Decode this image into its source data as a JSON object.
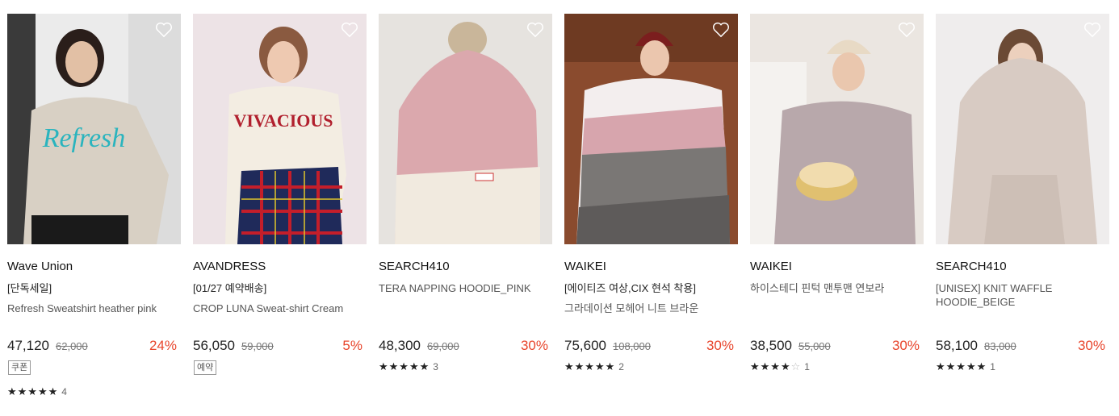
{
  "products": [
    {
      "brand": "Wave Union",
      "tag": "[단독세일]",
      "name": "Refresh Sweatshirt heather pink",
      "price": "47,120",
      "original_price": "62,000",
      "discount": "24%",
      "badge": "쿠폰",
      "rating_stars": "★★★★★",
      "review_count": "4",
      "colors": {
        "bg": "#ececec",
        "top": "#d9d2c6",
        "accent": "#29b6c0"
      }
    },
    {
      "brand": "AVANDRESS",
      "tag": "[01/27 예약배송]",
      "name": "CROP LUNA Sweat-shirt Cream",
      "price": "56,050",
      "original_price": "59,000",
      "discount": "5%",
      "badge": "예약",
      "colors": {
        "bg": "#eadfe3",
        "top": "#f3ede2",
        "accent": "#b1202e"
      }
    },
    {
      "brand": "SEARCH410",
      "name": "TERA NAPPING HOODIE_PINK",
      "price": "48,300",
      "original_price": "69,000",
      "discount": "30%",
      "rating_stars": "★★★★",
      "rating_half": "★",
      "review_count": "3",
      "colors": {
        "bg": "#e8e4e0",
        "top": "#dba8ad",
        "accent": "#f1eadf"
      }
    },
    {
      "brand": "WAIKEI",
      "tag": "[에이티즈 여상,CIX 현석 착용]",
      "name": "그라데이션 모헤어 니트 브라운",
      "price": "75,600",
      "original_price": "108,000",
      "discount": "30%",
      "rating_stars": "★★★★★",
      "review_count": "2",
      "colors": {
        "bg": "#8a4b2e",
        "top": "#d7a5ad",
        "accent": "#7a7775"
      }
    },
    {
      "brand": "WAIKEI",
      "name": "하이스테디 핀턱 맨투맨 연보라",
      "price": "38,500",
      "original_price": "55,000",
      "discount": "30%",
      "rating_stars": "★★★★",
      "rating_empty": "☆",
      "review_count": "1",
      "colors": {
        "bg": "#ebe6e1",
        "top": "#b8a8ab",
        "accent": "#e0c070"
      }
    },
    {
      "brand": "SEARCH410",
      "name": "[UNISEX] KNIT WAFFLE HOODIE_BEIGE",
      "price": "58,100",
      "original_price": "83,000",
      "discount": "30%",
      "rating_stars": "★★★★★",
      "review_count": "1",
      "colors": {
        "bg": "#efeded",
        "top": "#d8cbc3",
        "accent": "#c8b8ae"
      }
    }
  ]
}
